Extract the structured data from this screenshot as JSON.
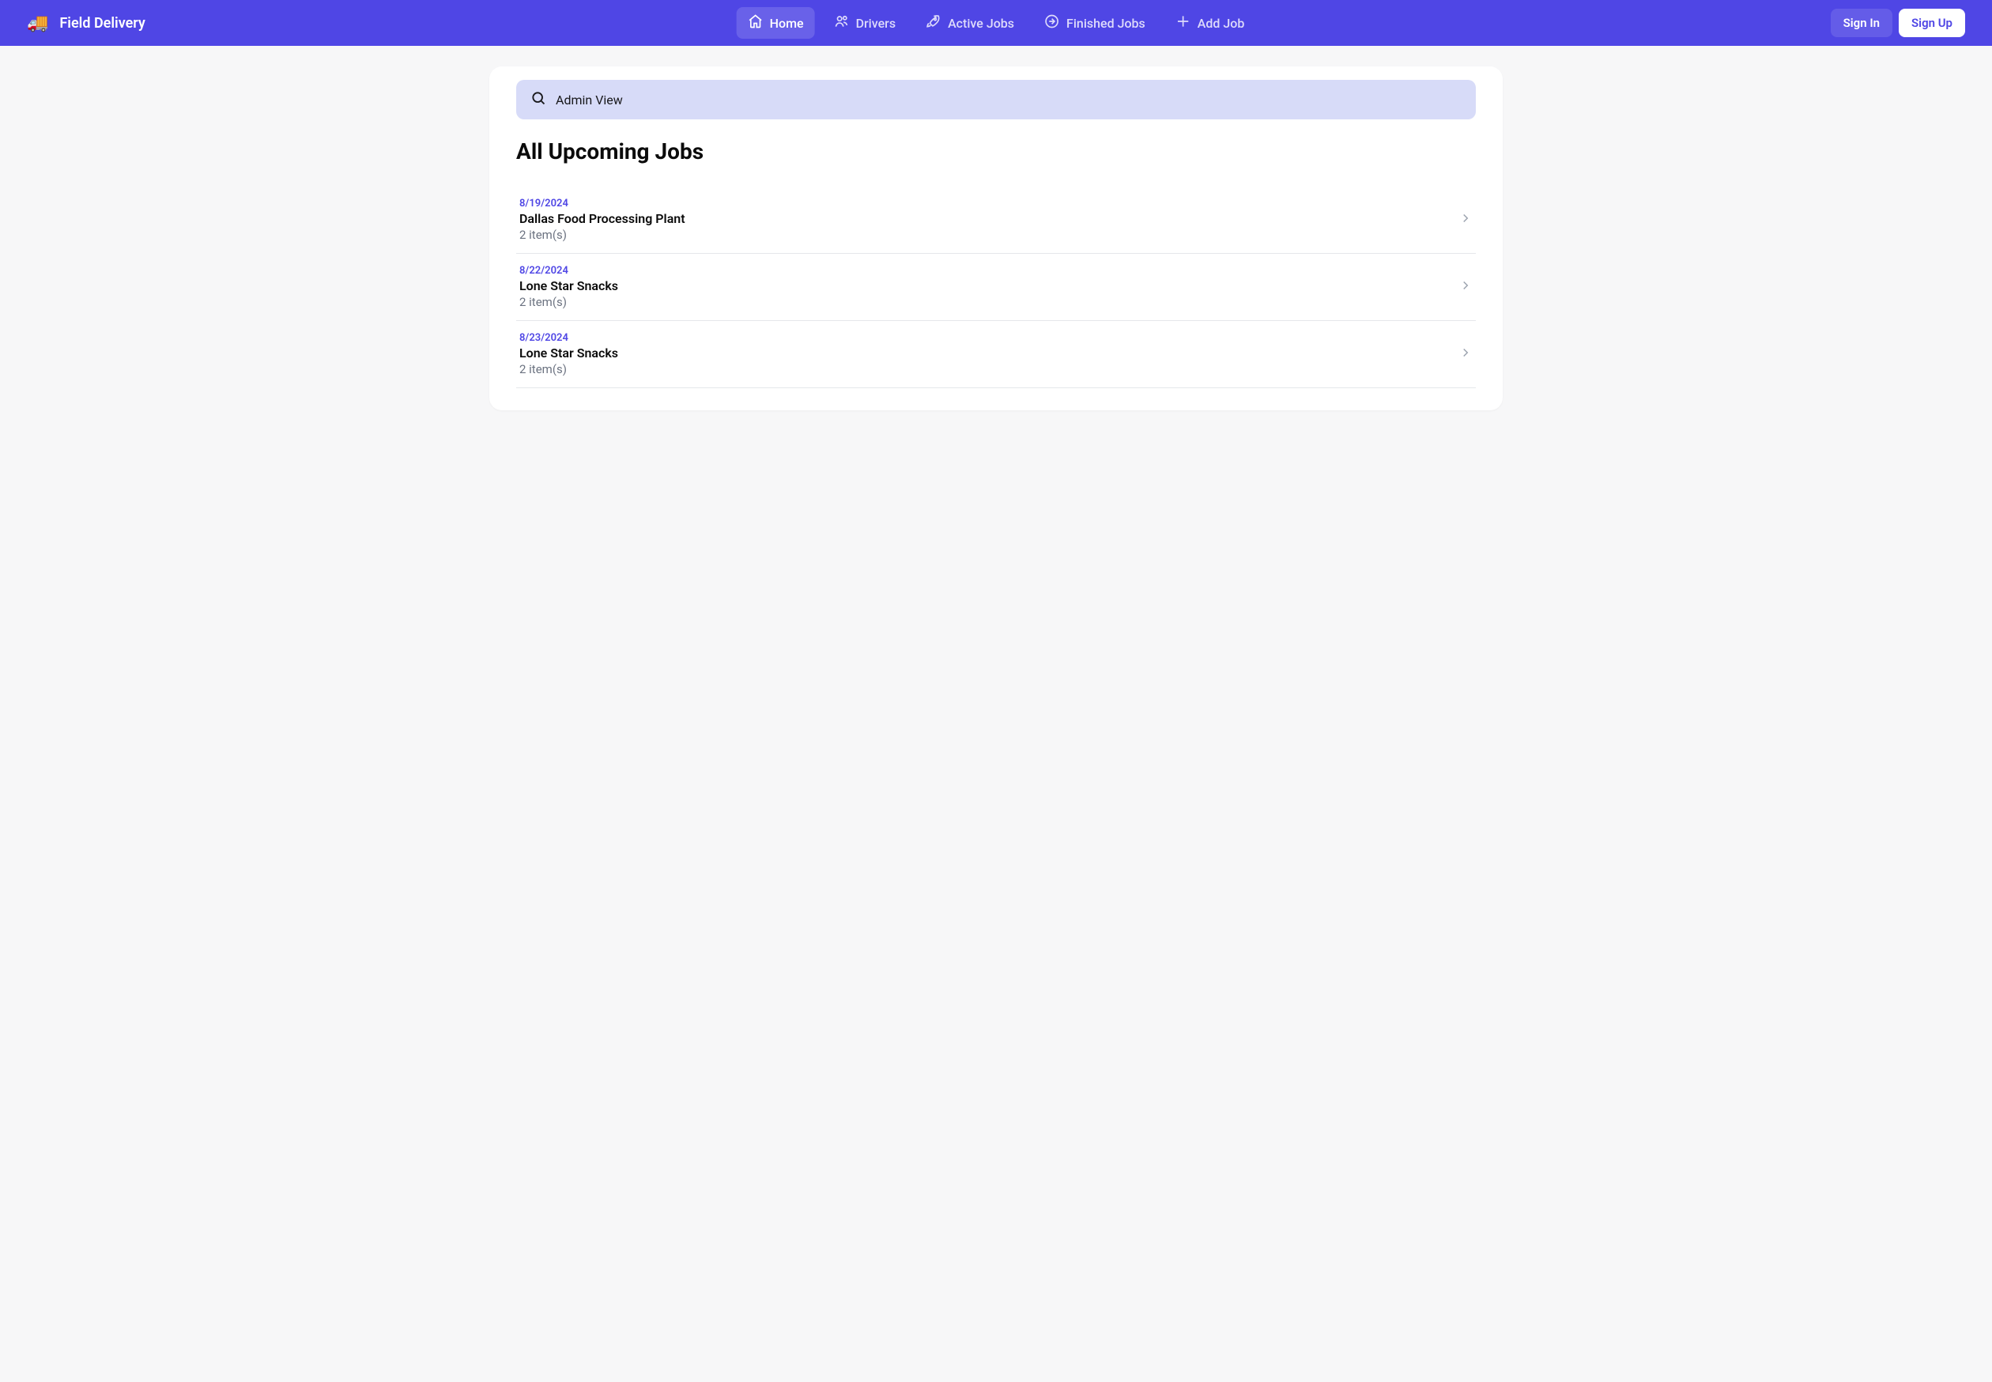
{
  "app": {
    "logo_emoji": "🚚",
    "title": "Field Delivery"
  },
  "nav": {
    "items": [
      {
        "label": "Home",
        "icon": "home-icon",
        "active": true
      },
      {
        "label": "Drivers",
        "icon": "users-icon",
        "active": false
      },
      {
        "label": "Active Jobs",
        "icon": "rocket-icon",
        "active": false
      },
      {
        "label": "Finished Jobs",
        "icon": "arrow-circle-icon",
        "active": false
      },
      {
        "label": "Add Job",
        "icon": "plus-icon",
        "active": false
      }
    ],
    "sign_in": "Sign In",
    "sign_up": "Sign Up"
  },
  "search": {
    "text": "Admin View"
  },
  "main": {
    "title": "All Upcoming Jobs",
    "jobs": [
      {
        "date": "8/19/2024",
        "title": "Dallas Food Processing Plant",
        "items": "2 item(s)"
      },
      {
        "date": "8/22/2024",
        "title": "Lone Star Snacks",
        "items": "2 item(s)"
      },
      {
        "date": "8/23/2024",
        "title": "Lone Star Snacks",
        "items": "2 item(s)"
      }
    ]
  }
}
